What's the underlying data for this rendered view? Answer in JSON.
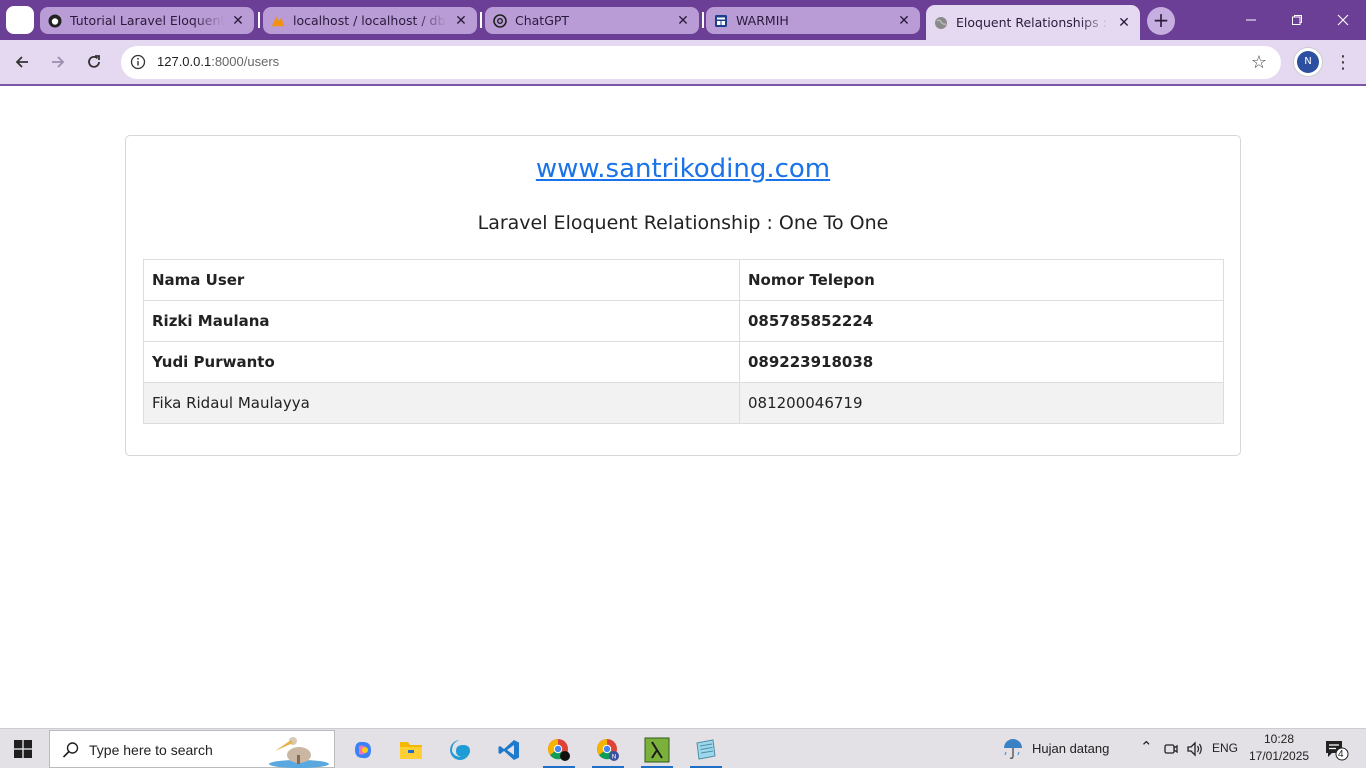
{
  "browser": {
    "tabs": [
      {
        "label": "Tutorial Laravel Eloquent Rel",
        "icon": "github-icon"
      },
      {
        "label": "localhost / localhost / db_elo",
        "icon": "phpmyadmin-icon"
      },
      {
        "label": "ChatGPT",
        "icon": "chatgpt-icon"
      },
      {
        "label": "WARMIH",
        "icon": "warmih-icon"
      },
      {
        "label": "Eloquent Relationships : Rela",
        "icon": "globe-icon",
        "active": true
      }
    ],
    "url_host": "127.0.0.1",
    "url_path": ":8000/users",
    "profile_initial": "N",
    "accent_color": "#6b3f96"
  },
  "page": {
    "site_link": "www.santrikoding.com",
    "heading": "Laravel Eloquent Relationship : One To One",
    "table": {
      "headers": [
        "Nama User",
        "Nomor Telepon"
      ],
      "rows": [
        {
          "name": "Rizki Maulana",
          "phone": "085785852224"
        },
        {
          "name": "Yudi Purwanto",
          "phone": "089223918038"
        },
        {
          "name": "Fika Ridaul Maulayya",
          "phone": "081200046719"
        }
      ]
    }
  },
  "taskbar": {
    "search_placeholder": "Type here to search",
    "weather": "Hujan datang",
    "language": "ENG",
    "time": "10:28",
    "date": "17/01/2025",
    "notification_count": "4"
  }
}
